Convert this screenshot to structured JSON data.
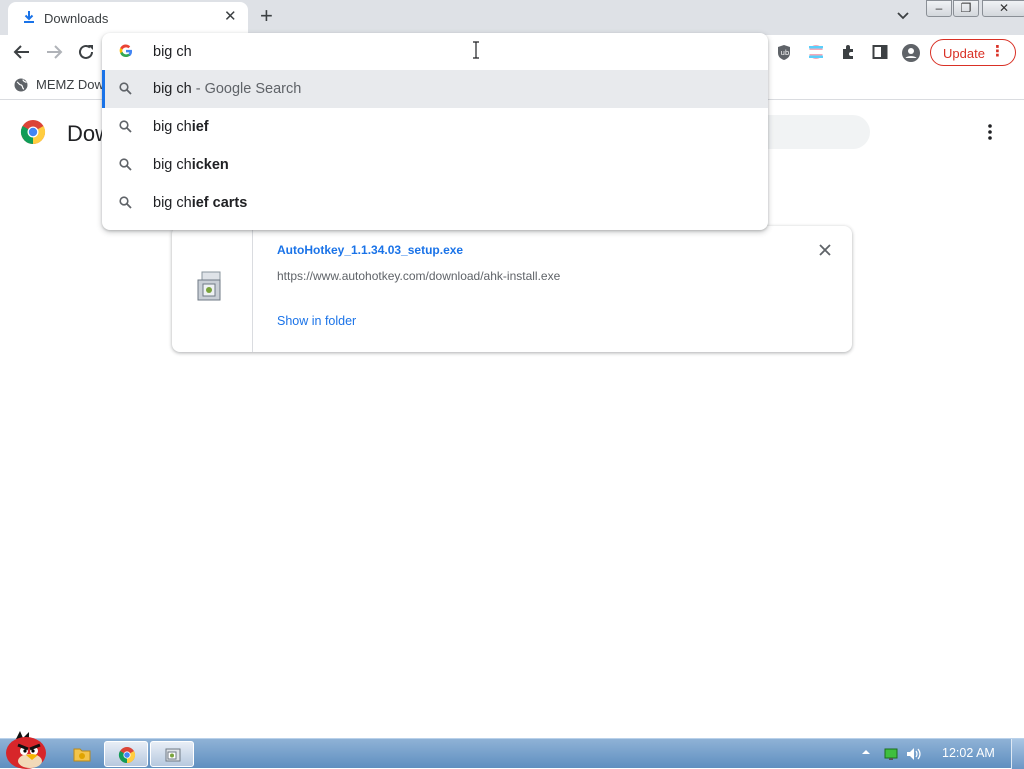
{
  "tab": {
    "title": "Downloads",
    "close_glyph": "✕"
  },
  "newtab_glyph": "+",
  "window_buttons": {
    "minimize": "‒",
    "restore": "❐",
    "close": "✕"
  },
  "toolbar": {
    "update_label": "Update",
    "menu_glyph": "⋮"
  },
  "bookmarks": [
    {
      "label": "MEMZ Dow"
    }
  ],
  "page": {
    "title": "Dow",
    "menu_glyph": "⋮"
  },
  "download": {
    "filename": "AutoHotkey_1.1.34.03_setup.exe",
    "url": "https://www.autohotkey.com/download/ahk-install.exe",
    "action": "Show in folder",
    "remove_glyph": "✕"
  },
  "omnibox": {
    "input": "big ch",
    "suggestions": [
      {
        "prefix": "big ch",
        "bold": "",
        "hint": " - Google Search"
      },
      {
        "prefix": "big ch",
        "bold": "ief",
        "hint": ""
      },
      {
        "prefix": "big ch",
        "bold": "icken",
        "hint": ""
      },
      {
        "prefix": "big ch",
        "bold": "ief carts",
        "hint": ""
      }
    ]
  },
  "taskbar": {
    "clock": "12:02 AM"
  },
  "colors": {
    "accent": "#1a73e8",
    "update_red": "#d93025",
    "tabstrip": "#dee1e6"
  }
}
